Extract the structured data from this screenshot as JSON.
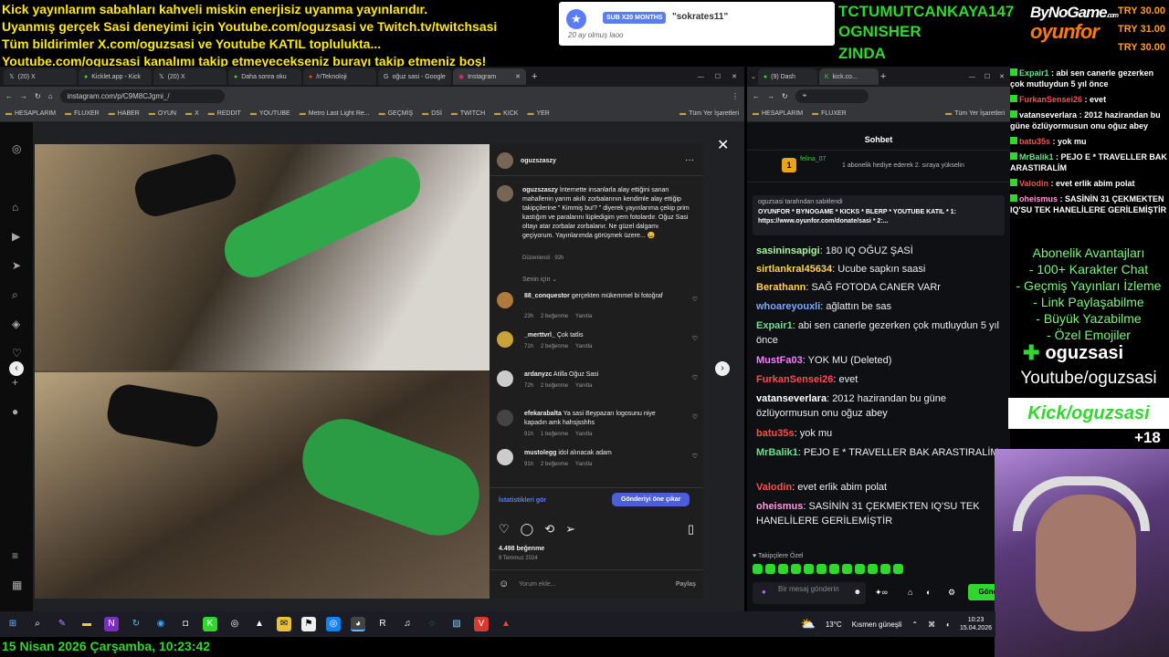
{
  "ticker": [
    "Kick yayınlarım sabahları kahveli miskin enerjisiz uyanma yayınlarıdır.",
    "Uyanmış gerçek Sasi deneyimi için Youtube.com/oguzsasi ve Twitch.tv/twitchsasi",
    "Tüm bildirimler X.com/oguzsasi ve Youtube KATIL toplulukta...",
    "Youtube.com/oguzsasi kanalımı takip etmeyecekseniz burayı takip etmeniz boş!"
  ],
  "sub_alert": {
    "badge": "SUB X20 MONTHS",
    "user": "\"sokrates11\"",
    "message": "20 ay olmuş laoo"
  },
  "top_names": [
    "TCTUMUTCANKAYA147",
    "OGNISHER",
    "ZINDA"
  ],
  "brand": {
    "line1": "ByNoGame",
    "line1_sup": ".com",
    "line2": "oyunfor"
  },
  "tries": [
    "TRY 30.00",
    "TRY 31.00",
    "TRY 30.00"
  ],
  "left_browser": {
    "tabs": [
      "(20) X",
      "Kicklet.app - Kick",
      "(20) X",
      "Daha sonra oku",
      "/r/Teknoloji",
      "oğuz sasi - Google",
      "Instagram"
    ],
    "url": "instagram.com/p/C9M8CJgmi_/",
    "bookmarks": [
      "HESAPLARIM",
      "FLUXER",
      "HABER",
      "OYUN",
      "X",
      "REDDIT",
      "YOUTUBE",
      "Metro Last Light Re...",
      "GEÇMİŞ",
      "DSİ",
      "TWITCH",
      "KICK",
      "YER",
      "Tüm Yer İşaretleri"
    ]
  },
  "post": {
    "author": "oguzszaszy",
    "caption_user": "oguzszaszy",
    "caption": "İnternette insanlarla alay ettiğini sanan mahallenin yarım akıllı zorbalarının kendimle alay ettiğip takipçilerine \" Kimmiş bu!? \" diyerek yayınlarıma çekip prim kastığım ve paralarını lüpledigim yem fotolardır. Oğuz Sasi oltayı atar zorbalar zorbalanır. Ne güzel dalgamı geçiyorum. Yayınlarımda görüşmek üzere... 😀",
    "edited": "Düzenlendi · 92h",
    "for_you": "Senin için",
    "comments": [
      {
        "user": "88_conquestor",
        "text": "gerçekten mükemmel bi fotoğraf",
        "time": "23h",
        "likes": "2 beğenme",
        "reply": "Yanıtla"
      },
      {
        "user": "_merttvrl_",
        "text": "Çok tatlis",
        "time": "71h",
        "likes": "2 beğenme",
        "reply": "Yanıtla"
      },
      {
        "user": "ardanyzc",
        "text": "Atilla Oğuz Sasi",
        "time": "72h",
        "likes": "2 beğenme",
        "reply": "Yanıtla"
      },
      {
        "user": "efekarabalta",
        "text": "Ya sasi Beypazarı logosunu niye kapadın amk hahsjsshhs",
        "time": "91h",
        "likes": "1 beğenme",
        "reply": "Yanıtla"
      },
      {
        "user": "mustolegg",
        "text": "idol alınacak adam",
        "time": "91h",
        "likes": "2 beğenme",
        "reply": "Yanıtla"
      }
    ],
    "insights": "İstatistikleri gör",
    "boost": "Gönderiyi öne çıkar",
    "likes": "4.498 beğenme",
    "date": "9 Temmuz 2024",
    "comment_placeholder": "Yorum ekle...",
    "share": "Paylaş"
  },
  "right_browser": {
    "tabs": [
      "(9) Dash",
      "kick.co..."
    ],
    "bookmarks": [
      "HESAPLARIM",
      "FLUXER",
      "Tüm Yer İşaretleri"
    ],
    "chat_title": "Sohbet",
    "gift_user": "felina_07",
    "gift_count": "1",
    "gift_text": "1 abonelik hediye ederek 2. sıraya yükselin",
    "pinned_by": "oguzsasi tarafından sabitlendi",
    "pinned_text": "OYUNFOR * BYNOGAME * KICKS * BLERP * YOUTUBE KATIL * 1: https://www.oyunfor.com/donate/sasi * 2:...",
    "messages": [
      {
        "user": "sasininsapigi",
        "color": "#a7f5a0",
        "text": "180 IQ OĞUZ ŞASİ"
      },
      {
        "user": "sirtlankral45634",
        "color": "#ffd34e",
        "text": "Ucube sapkın saasi"
      },
      {
        "user": "Berathann",
        "color": "#ffd34e",
        "text": "SAĞ FOTODA CANER VARr"
      },
      {
        "user": "whoareyouxli",
        "color": "#7aa7ff",
        "text": "ağlattın be sas"
      },
      {
        "user": "Expair1",
        "color": "#69e28b",
        "text": "abi sen canerle gezerken çok mutluydun 5 yıl önce"
      },
      {
        "user": "MustFa03",
        "color": "#ff7aff",
        "text": "YOK MU (Deleted)"
      },
      {
        "user": "FurkanSensei26",
        "color": "#ff4d4d",
        "text": "evet"
      },
      {
        "user": "vatanseverlara",
        "color": "#ffffff",
        "text": "2012 hazirandan bu güne özlüyormusun onu oğuz abey"
      },
      {
        "user": "batu35s",
        "color": "#ff4d4d",
        "text": "yok mu"
      },
      {
        "user": "MrBalik1",
        "color": "#69e28b",
        "text": "PEJO E * TRAVELLER BAK ARASTIRALİM"
      },
      {
        "user": "Valodin",
        "color": "#ff4d4d",
        "text": "evet erlik abim polat"
      },
      {
        "user": "oheismus",
        "color": "#ff9ae0",
        "text": "SASİNİN 31 ÇEKMEKTEN IQ'SU TEK HANELİLERE GERİLEMİŞTİR"
      }
    ],
    "followers_label": "Takipçilere Özel",
    "input_placeholder": "Bir mesaj gönderin",
    "send": "Gönd"
  },
  "right_chat": [
    {
      "user": "Expair1",
      "color": "#69e28b",
      "text": "abi sen canerle gezerken çok mutluydun 5 yıl önce"
    },
    {
      "user": "FurkanSensei26",
      "color": "#ff4d4d",
      "text": "evet"
    },
    {
      "user": "vatanseverlara",
      "color": "#ffffff",
      "text": "2012 hazirandan bu güne özlüyormusun onu oğuz abey"
    },
    {
      "user": "batu35s",
      "color": "#ff4d4d",
      "text": "yok mu"
    },
    {
      "user": "MrBalik1",
      "color": "#69e28b",
      "text": "PEJO E * TRAVELLER BAK ARASTIRALİM"
    },
    {
      "user": "Valodin",
      "color": "#ff4d4d",
      "text": "evet erlik abim polat"
    },
    {
      "user": "oheismus",
      "color": "#ff9ae0",
      "text": "SASİNİN 31 ÇEKMEKTEN IQ'SU TEK HANELİLERE GERİLEMİŞTİR"
    }
  ],
  "perks": [
    "Abonelik Avantajları",
    "- 100+ Karakter Chat",
    "- Geçmiş Yayınları İzleme",
    "- Link Paylaşabilme",
    "- Büyük Yazabilme",
    "- Özel Emojiler"
  ],
  "socials": {
    "kick_user": "oguzsasi",
    "youtube": "Youtube/oguzsasi",
    "kick": "Kick/oguzsasi",
    "plus": "+18"
  },
  "taskbar": {
    "weather": "13°C",
    "weather_desc": "Kısmen güneşli",
    "time": "10:23",
    "date": "15.04.2026"
  },
  "datetime": "15 Nisan 2026 Çarşamba, 10:23:42"
}
